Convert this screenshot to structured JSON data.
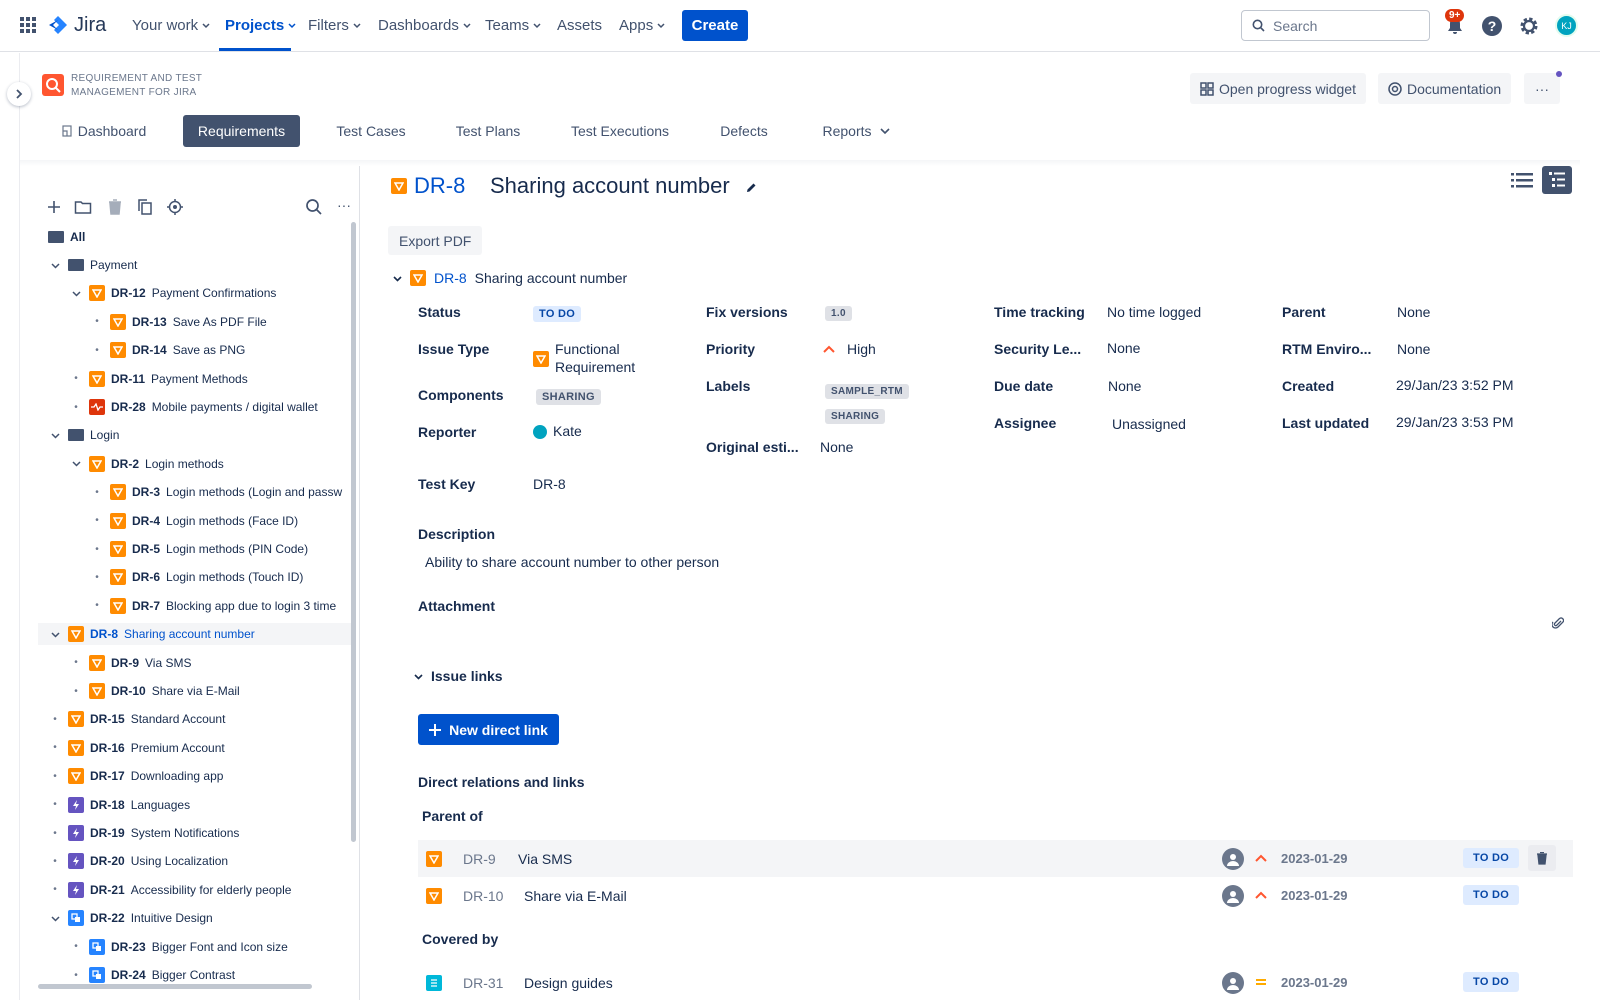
{
  "topnav": {
    "product": "Jira",
    "items": [
      "Your work",
      "Projects",
      "Filters",
      "Dashboards",
      "Teams",
      "Assets",
      "Apps"
    ],
    "create": "Create",
    "search_placeholder": "Search",
    "notif_badge": "9+",
    "avatar_initials": "KJ"
  },
  "app": {
    "title_line1": "REQUIREMENT AND TEST",
    "title_line2": "MANAGEMENT FOR JIRA",
    "progress_widget": "Open progress widget",
    "documentation": "Documentation",
    "more": "···"
  },
  "tabs": [
    "Dashboard",
    "Requirements",
    "Test Cases",
    "Test Plans",
    "Test Executions",
    "Defects",
    "Reports"
  ],
  "tree": {
    "all": "All",
    "rows": [
      {
        "key": "",
        "label": "Payment"
      },
      {
        "key": "DR-12",
        "label": "Payment Confirmations"
      },
      {
        "key": "DR-13",
        "label": "Save As PDF File"
      },
      {
        "key": "DR-14",
        "label": "Save as PNG"
      },
      {
        "key": "DR-11",
        "label": "Payment Methods"
      },
      {
        "key": "DR-28",
        "label": "Mobile payments / digital wallet"
      },
      {
        "key": "",
        "label": "Login"
      },
      {
        "key": "DR-2",
        "label": "Login methods"
      },
      {
        "key": "DR-3",
        "label": "Login methods (Login and passw"
      },
      {
        "key": "DR-4",
        "label": "Login methods (Face ID)"
      },
      {
        "key": "DR-5",
        "label": "Login methods (PIN Code)"
      },
      {
        "key": "DR-6",
        "label": "Login methods (Touch ID)"
      },
      {
        "key": "DR-7",
        "label": "Blocking app due to login 3 time"
      },
      {
        "key": "DR-8",
        "label": "Sharing account number"
      },
      {
        "key": "DR-9",
        "label": "Via SMS"
      },
      {
        "key": "DR-10",
        "label": "Share via E-Mail"
      },
      {
        "key": "DR-15",
        "label": "Standard Account"
      },
      {
        "key": "DR-16",
        "label": "Premium Account"
      },
      {
        "key": "DR-17",
        "label": "Downloading app"
      },
      {
        "key": "DR-18",
        "label": "Languages"
      },
      {
        "key": "DR-19",
        "label": "System Notifications"
      },
      {
        "key": "DR-20",
        "label": "Using Localization"
      },
      {
        "key": "DR-21",
        "label": "Accessibility for elderly people"
      },
      {
        "key": "DR-22",
        "label": "Intuitive Design"
      },
      {
        "key": "DR-23",
        "label": "Bigger Font and Icon size"
      },
      {
        "key": "DR-24",
        "label": "Bigger Contrast"
      }
    ]
  },
  "issue": {
    "key": "DR-8",
    "summary": "Sharing account number",
    "export_pdf": "Export PDF",
    "fields": {
      "status_label": "Status",
      "status": "TO DO",
      "issue_type_label": "Issue Type",
      "issue_type_1": "Functional",
      "issue_type_2": "Requirement",
      "components_label": "Components",
      "components": "SHARING",
      "reporter_label": "Reporter",
      "reporter": "Kate",
      "fix_versions_label": "Fix versions",
      "fix_versions": "1.0",
      "priority_label": "Priority",
      "priority": "High",
      "labels_label": "Labels",
      "label_1": "SAMPLE_RTM",
      "label_2": "SHARING",
      "original_label": "Original esti...",
      "original": "None",
      "time_tracking_label": "Time tracking",
      "time_tracking": "No time logged",
      "security_label": "Security Le...",
      "security": "None",
      "due_date_label": "Due date",
      "due_date": "None",
      "assignee_label": "Assignee",
      "assignee": "Unassigned",
      "parent_label": "Parent",
      "parent": "None",
      "rtm_env_label": "RTM Enviro...",
      "rtm_env": "None",
      "created_label": "Created",
      "created": "29/Jan/23 3:52 PM",
      "updated_label": "Last updated",
      "updated": "29/Jan/23 3:53 PM",
      "test_key_label": "Test Key",
      "test_key": "DR-8"
    },
    "description_label": "Description",
    "description": "Ability to share account number to other person",
    "attachment_label": "Attachment",
    "issue_links_label": "Issue links",
    "new_link": "New direct link",
    "relations_label": "Direct relations and links",
    "parent_of_label": "Parent of",
    "covered_by_label": "Covered by",
    "parent_of": [
      {
        "key": "DR-9",
        "summary": "Via SMS",
        "date": "2023-01-29",
        "status": "TO DO"
      },
      {
        "key": "DR-10",
        "summary": "Share via E-Mail",
        "date": "2023-01-29",
        "status": "TO DO"
      }
    ],
    "covered_by": [
      {
        "key": "DR-31",
        "summary": "Design guides",
        "date": "2023-01-29",
        "status": "TO DO"
      }
    ]
  }
}
